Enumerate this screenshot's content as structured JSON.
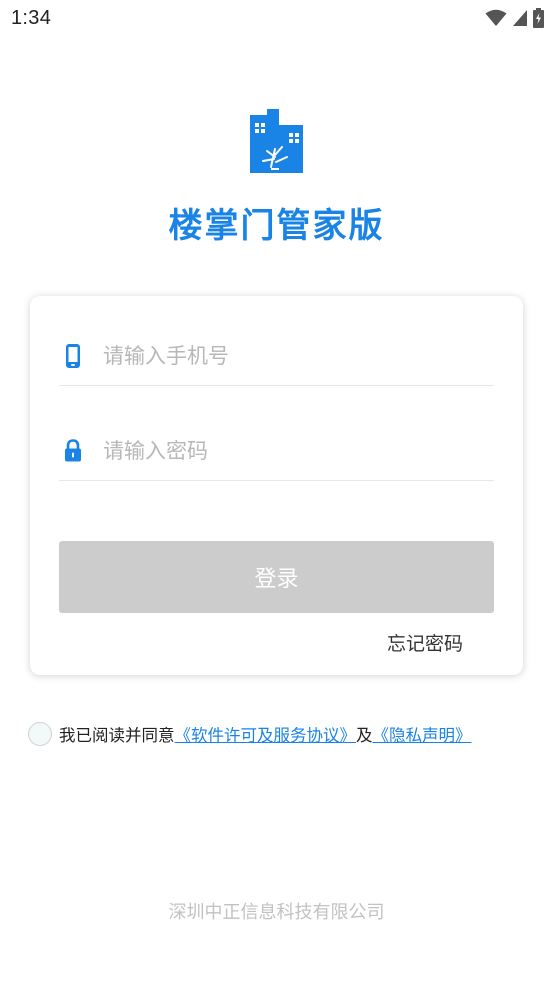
{
  "status_bar": {
    "time": "1:34",
    "icons": [
      "wifi-icon",
      "signal-icon",
      "battery-charging-icon"
    ]
  },
  "brand": {
    "app_name": "楼掌门管家版",
    "logo_icon": "building-logo-icon",
    "accent_color": "#1a84e6"
  },
  "login_form": {
    "phone_placeholder": "请输入手机号",
    "phone_value": "",
    "phone_icon": "mobile-phone-icon",
    "password_placeholder": "请输入密码",
    "password_value": "",
    "password_icon": "lock-icon",
    "submit_label": "登录",
    "submit_color": "#cccccc",
    "forgot_label": "忘记密码"
  },
  "agreement": {
    "checked": false,
    "prefix": "我已阅读并同意",
    "license_link": "《软件许可及服务协议》",
    "conjunction": "及",
    "privacy_link": "《隐私声明》"
  },
  "footer": {
    "company": "深圳中正信息科技有限公司"
  }
}
